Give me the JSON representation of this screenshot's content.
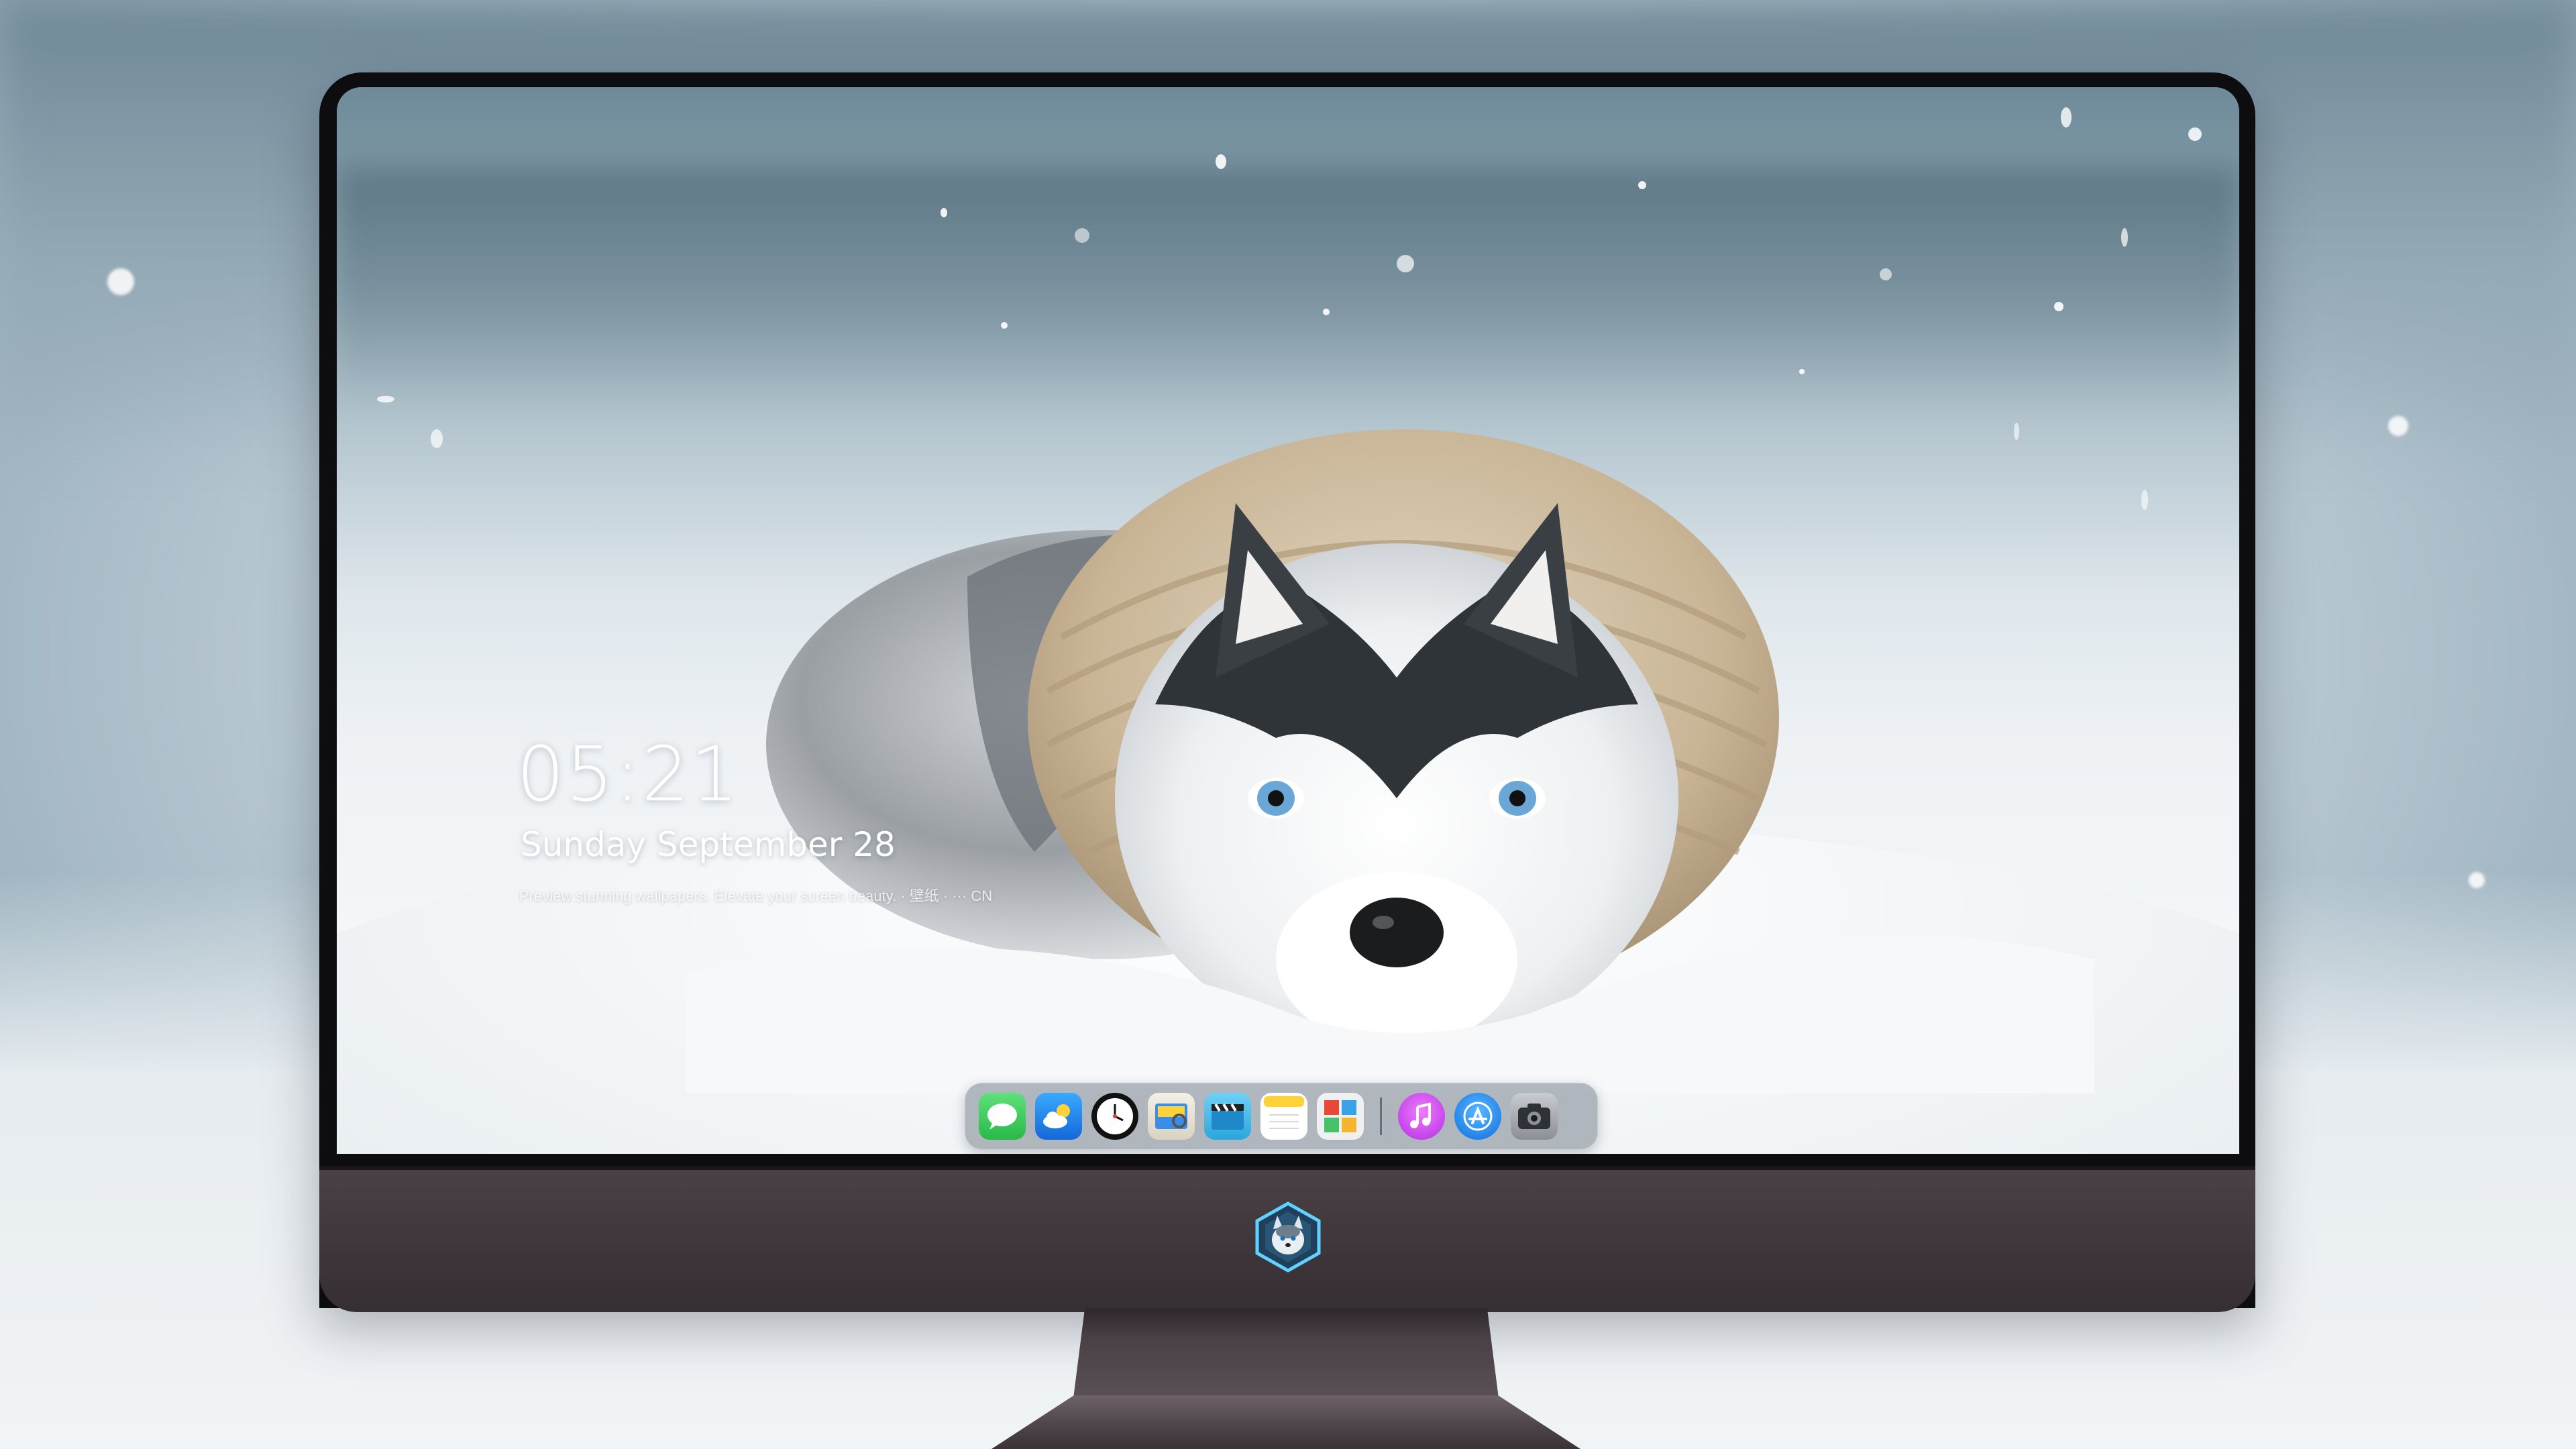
{
  "lock_screen": {
    "time": "05:21",
    "date": "Sunday September  28",
    "tagline": "Preview stunning wallpapers. Elevate your screen beauty. · 壁纸 · ··· CN"
  },
  "dock": {
    "apps": [
      {
        "icon": "messages-icon",
        "color": "#34c759"
      },
      {
        "icon": "weather-icon",
        "color": "#1e8ff0"
      },
      {
        "icon": "clock-icon",
        "color": "#111111"
      },
      {
        "icon": "preview-icon",
        "color": "#e8c95a"
      },
      {
        "icon": "clips-icon",
        "color": "#3fb6e8"
      },
      {
        "icon": "notes-icon",
        "color": "#ffd23a"
      },
      {
        "icon": "photo-booth-icon",
        "color": "#e9ecef"
      }
    ],
    "pinned": [
      {
        "icon": "itunes-icon",
        "color": "#d63cf0"
      },
      {
        "icon": "app-store-icon",
        "color": "#1a8cff"
      },
      {
        "icon": "camera-icon",
        "color": "#555a60"
      }
    ]
  },
  "colors": {
    "bezel": "#0d0d0f",
    "chin": "#3d3539",
    "screen_sky": "#7a93a1",
    "snow": "#f3f6f8"
  }
}
